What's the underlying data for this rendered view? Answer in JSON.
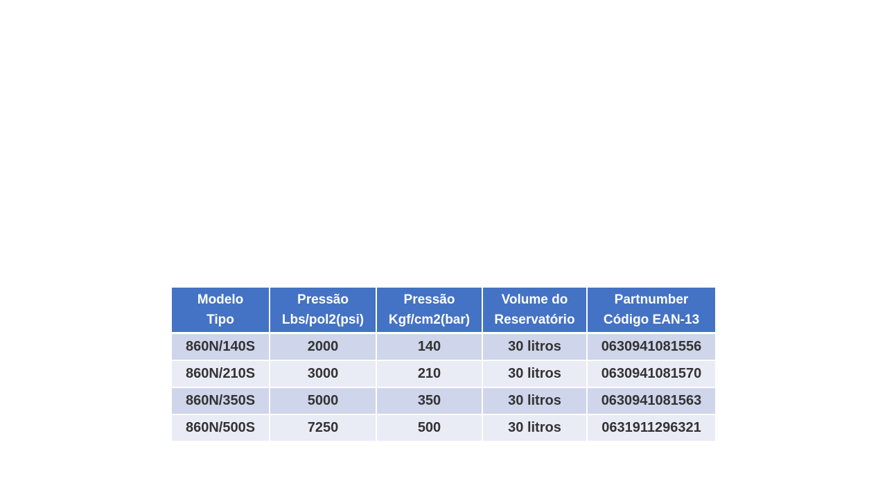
{
  "table": {
    "headers": [
      {
        "line1": "Modelo",
        "line2": "Tipo"
      },
      {
        "line1": "Pressão",
        "line2": "Lbs/pol2(psi)"
      },
      {
        "line1": "Pressão",
        "line2": "Kgf/cm2(bar)"
      },
      {
        "line1": "Volume do",
        "line2": "Reservatório"
      },
      {
        "line1": "Partnumber",
        "line2": "Código EAN-13"
      }
    ],
    "rows": [
      [
        "860N/140S",
        "2000",
        "140",
        "30 litros",
        "0630941081556"
      ],
      [
        "860N/210S",
        "3000",
        "210",
        "30 litros",
        "0630941081570"
      ],
      [
        "860N/350S",
        "5000",
        "350",
        "30 litros",
        "0630941081563"
      ],
      [
        "860N/500S",
        "7250",
        "500",
        "30 litros",
        "0631911296321"
      ]
    ],
    "colors": {
      "header_bg": "#4472c4",
      "row_odd_bg": "#cfd5ea",
      "row_even_bg": "#e9ebf5",
      "header_text": "#ffffff",
      "body_text": "#333333"
    }
  }
}
